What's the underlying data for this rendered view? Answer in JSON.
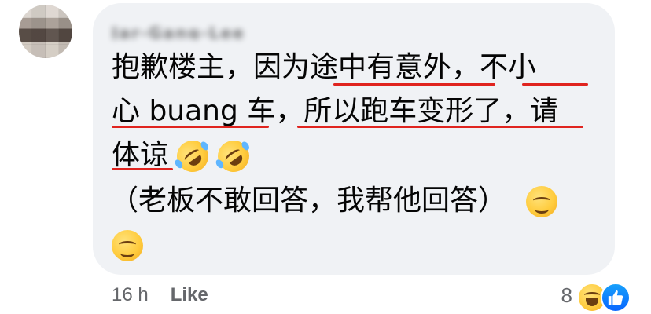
{
  "comment": {
    "author": "Jar-Gang-Lee",
    "lines": [
      "抱歉楼主，因为途中有意外，不小",
      "心 buang 车，所以跑车变形了，请",
      "体谅",
      "（老板不敢回答，我帮他回答）",
      ""
    ]
  },
  "footer": {
    "time": "16 h",
    "like_label": "Like"
  },
  "reactions": {
    "count": "8",
    "types": [
      "haha-icon",
      "like-icon"
    ]
  },
  "colors": {
    "bubble": "#f0f2f5",
    "underline": "#e0241f",
    "meta_text": "#65676b"
  }
}
